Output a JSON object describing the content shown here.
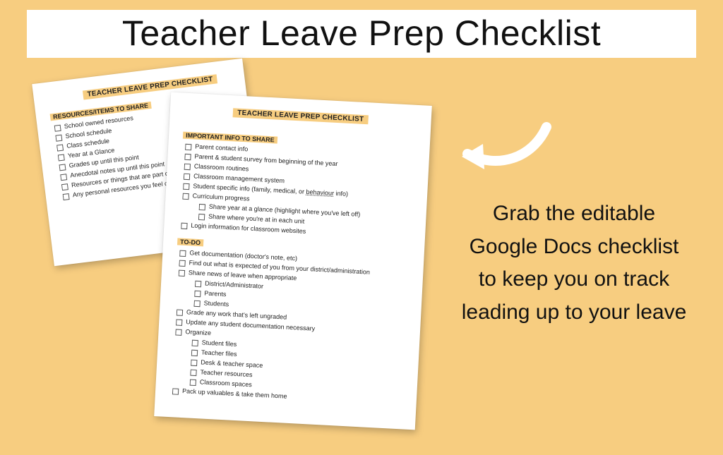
{
  "banner": {
    "title": "Teacher Leave Prep Checklist"
  },
  "cta": {
    "text": "Grab the editable Google Docs checklist to keep you on track leading up to your leave"
  },
  "docSheets": {
    "docTitle": "TEACHER LEAVE PREP CHECKLIST",
    "back": {
      "section": "RESOURCES/ITEMS TO SHARE",
      "items": [
        "School owned resources",
        "School schedule",
        "Class schedule",
        "Year at a Glance",
        "Grades up until this point",
        "Anecdotal notes up until this point",
        "Resources or things that are part of your",
        "Any personal resources you feel comfo  rotation slides, classroom management"
      ]
    },
    "front": {
      "section1": {
        "title": "IMPORTANT INFO TO SHARE",
        "items": [
          "Parent contact info",
          "Parent & student survey from beginning of the year",
          "Classroom routines",
          "Classroom management system"
        ],
        "studentInfoPrefix": "Student specific info (family, medical, or ",
        "studentInfoDotted": "behaviour",
        "studentInfoSuffix": " info)",
        "curriculum": "Curriculum progress",
        "curriculumSub": [
          "Share year at a glance (highlight where you've left off)",
          "Share where you're at in each unit"
        ],
        "login": "Login information for classroom websites"
      },
      "section2": {
        "title": "TO-DO",
        "items1": [
          "Get documentation (doctor's note, etc)",
          "Find out what is expected of you from your district/administration",
          "Share news of leave when appropriate"
        ],
        "shareSub": [
          "District/Administrator",
          "Parents",
          "Students"
        ],
        "items2": [
          "Grade any work that's left ungraded",
          "Update any student documentation necessary",
          "Organize"
        ],
        "organizeSub": [
          "Student files",
          "Teacher files",
          "Desk & teacher space",
          "Teacher resources",
          "Classroom spaces"
        ],
        "last": "Pack up valuables & take them home"
      }
    }
  }
}
